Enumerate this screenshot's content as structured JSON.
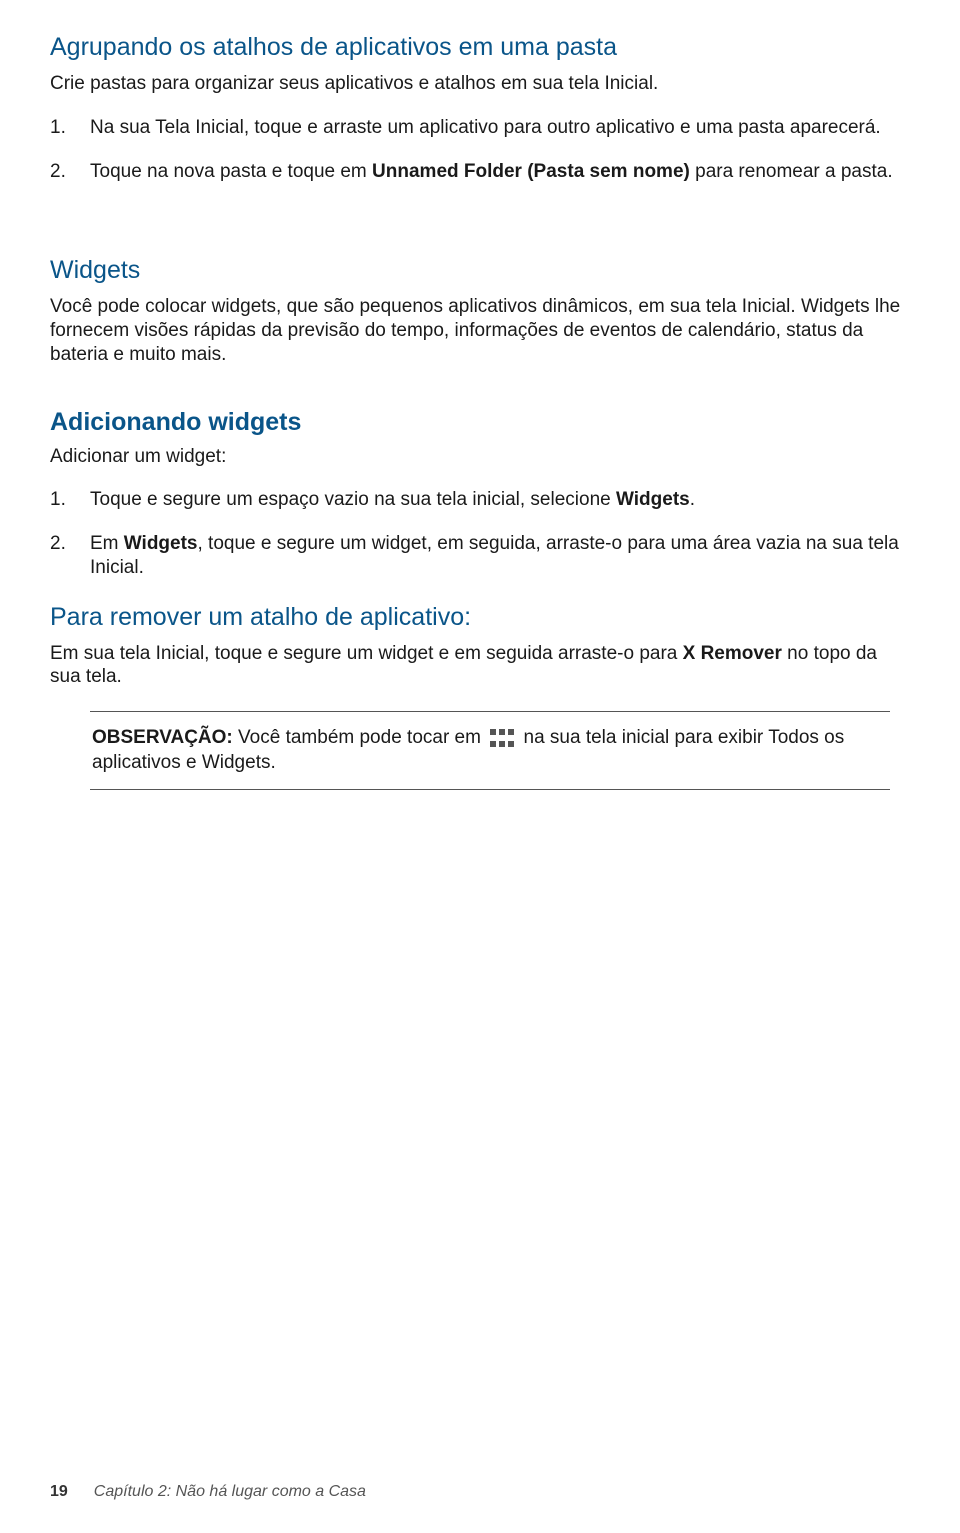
{
  "section1": {
    "heading": "Agrupando os atalhos de aplicativos em uma pasta",
    "intro": "Crie pastas para organizar seus aplicativos e atalhos em sua tela Inicial.",
    "steps": [
      {
        "pre": "Na sua Tela Inicial, toque e arraste um aplicativo para outro aplicativo e uma pasta aparecerá."
      },
      {
        "pre": "Toque na nova pasta e toque em ",
        "bold": "Unnamed Folder (Pasta sem nome)",
        "post": " para renomear a pasta."
      }
    ]
  },
  "section2": {
    "heading": "Widgets",
    "body": "Você pode colocar widgets, que são pequenos aplicativos dinâmicos, em sua tela Inicial. Widgets lhe fornecem visões rápidas da previsão do tempo, informações de eventos de calendário, status da bateria e muito mais."
  },
  "section3": {
    "heading": "Adicionando widgets",
    "intro": "Adicionar um widget:",
    "steps": [
      {
        "pre": "Toque e segure um espaço vazio na sua tela inicial, selecione ",
        "bold": "Widgets",
        "post": "."
      },
      {
        "pre": "Em ",
        "bold": "Widgets",
        "post": ", toque e segure um widget, em seguida, arraste-o para uma área vazia na sua tela Inicial."
      }
    ]
  },
  "section4": {
    "heading": "Para remover um atalho de aplicativo:",
    "body_pre": "Em sua tela Inicial, toque e segure um widget e em seguida arraste-o para ",
    "body_bold": "X Remover",
    "body_post": " no topo da sua tela."
  },
  "note": {
    "label": "OBSERVAÇÃO:",
    "pre": " Você também pode tocar em ",
    "post": " na sua tela inicial para exibir  Todos os aplicativos e Widgets."
  },
  "footer": {
    "page": "19",
    "chapter": "Capítulo 2:  Não há lugar como a Casa"
  }
}
